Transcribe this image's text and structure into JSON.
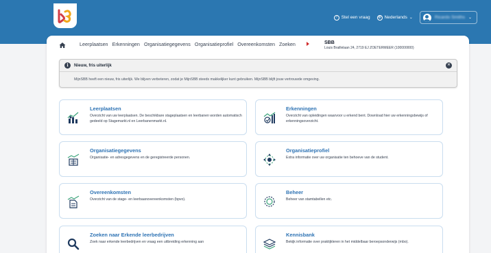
{
  "header": {
    "help_label": "Stel een vraag",
    "language_label": "Nederlands",
    "user_name": "Ricardo Smiths"
  },
  "nav": {
    "items": [
      "Leerplaatsen",
      "Erkenningen",
      "Organisatiegegevens",
      "Organisatieprofiel",
      "Overeenkomsten",
      "Zoeken"
    ],
    "org_name": "SBB",
    "org_address": "Louis Braillelaan 24, 2719 EJ ZOETERMEER (100000000)"
  },
  "notice": {
    "title": "Nieuw, fris uiterlijk",
    "text": "MijnSBB heeft een nieuw, fris uiterlijk. We blijven verbeteren, zodat je MijnSBB steeds makkelijker kunt gebruiken. MijnSBB blijft jouw vertrouwde omgeving."
  },
  "cards": [
    {
      "title": "Leerplaatsen",
      "description": "Overzicht van uw leerplaatsen. De beschikbare stageplaatsen en leerbanen worden automatisch gedeeld op Stagemarkt.nl en Leerbanenmarkt.nl.",
      "icon": "workplace-chart-icon"
    },
    {
      "title": "Erkenningen",
      "description": "Overzicht van opleidingen waarvoor u erkend bent. Download hier uw erkenningsbewijs of erkenningsoverzicht.",
      "icon": "recognition-chart-icon"
    },
    {
      "title": "Organisatiegegevens",
      "description": "Organisatie- en adresgegevens en de geregistreerde personen.",
      "icon": "organisation-data-icon"
    },
    {
      "title": "Organisatieprofiel",
      "description": "Extra informatie over uw organisatie ten behoeve van de student.",
      "icon": "profile-arrows-icon"
    },
    {
      "title": "Overeenkomsten",
      "description": "Overzicht van de stage- en leerbaanovereenkomsten (bpvo).",
      "icon": "agreement-document-icon"
    },
    {
      "title": "Beheer",
      "description": "Beheer van stamtabellen etc.",
      "icon": "settings-gear-icon"
    },
    {
      "title": "Zoeken naar Erkende leerbedrijven",
      "description": "Zoek naar erkende leerbedrijven en vraag een uitbreiding erkenning aan",
      "icon": "search-icon"
    },
    {
      "title": "Kennisbank",
      "description": "Bekijk informatie over praktijkleren in het middelbaar beroepsonderwijs (mbo).",
      "icon": "layers-icon"
    }
  ],
  "colors": {
    "header_blue": "#2b77b1",
    "card_title_blue": "#2e73b4",
    "icon_green": "#3aa37a",
    "icon_navy": "#1f3a5f"
  }
}
